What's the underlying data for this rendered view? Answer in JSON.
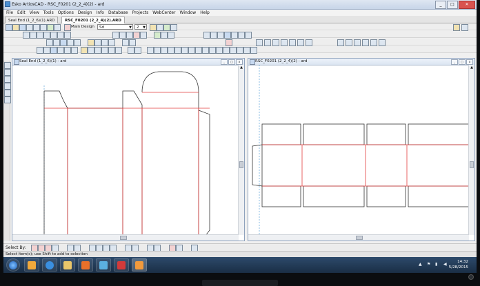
{
  "window": {
    "title": "Esko ArtiosCAD - RSC_F0201 (2_2_4)(2) - ard"
  },
  "menu": [
    "File",
    "Edit",
    "View",
    "Tools",
    "Options",
    "Design",
    "Info",
    "Database",
    "Projects",
    "WebCenter",
    "Window",
    "Help"
  ],
  "doc_tabs": [
    {
      "label": "Seal End (1_2_6)(1).ARD",
      "active": false
    },
    {
      "label": "RSC_F0201 (2_2_4)(2).ARD",
      "active": true
    }
  ],
  "toolbar": {
    "layer_label": "Main Design",
    "dropdown1": "Sd",
    "dropdown2": "2"
  },
  "panes": {
    "left": {
      "title": "Seal End (1_2_6)(1) - ard"
    },
    "right": {
      "title": "RSC_F0201 (2_2_4)(2) - ard"
    }
  },
  "select_by": {
    "label": "Select By:"
  },
  "status": {
    "text": "Select item(s); use Shift to add to selection"
  },
  "taskbar": {
    "time": "14:32",
    "date": "5/28/2015"
  },
  "colors": {
    "cut_line": "#333333",
    "crease_line": "#e23c3c",
    "guide_line": "#5aa0d8",
    "pane_background": "#ffffff"
  },
  "icons": [
    "start-orb-icon",
    "outlook-icon",
    "internet-explorer-icon",
    "file-explorer-icon",
    "office-icon",
    "remote-desktop-icon",
    "antivirus-icon",
    "app-icon",
    "speaker-icon",
    "flag-icon",
    "network-icon"
  ]
}
